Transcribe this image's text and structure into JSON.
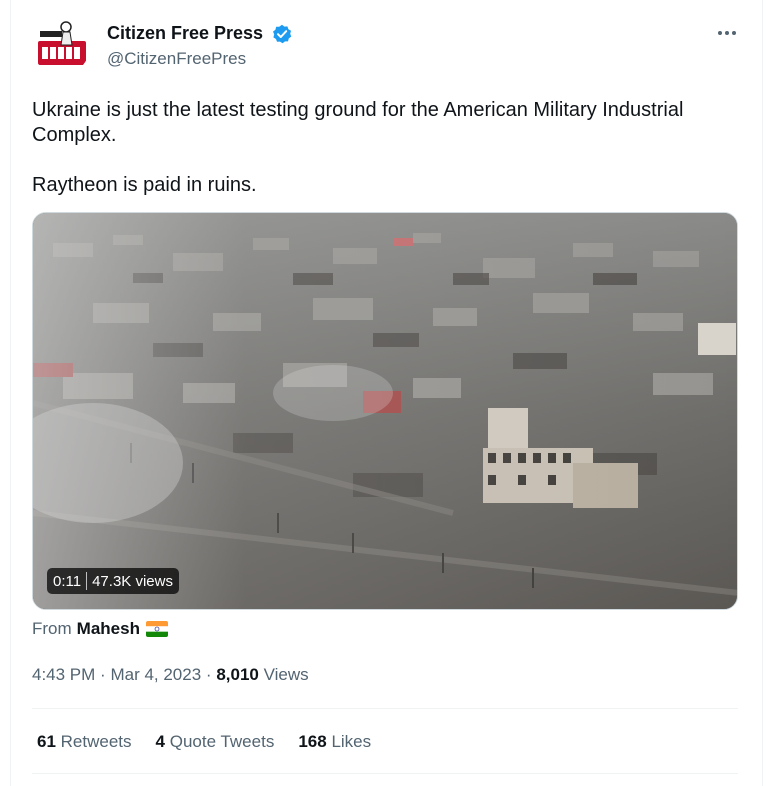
{
  "author": {
    "display_name": "Citizen Free Press",
    "handle": "@CitizenFreePres",
    "verified": true,
    "avatar_icon": "newspaper-logo-icon"
  },
  "tweet": {
    "text_line1": "Ukraine is just the latest testing ground for the American Military Industrial Complex.",
    "text_line2": "Raytheon is paid in ruins."
  },
  "media": {
    "type": "video",
    "duration": "0:11",
    "views": "47.3K views",
    "description_icon": "aerial-ruined-city-video"
  },
  "from_label": "From",
  "from_name": "Mahesh",
  "from_flag": "india-flag-icon",
  "meta": {
    "time": "4:43 PM",
    "separator": "·",
    "date": "Mar 4, 2023",
    "views_count": "8,010",
    "views_label": "Views"
  },
  "stats": {
    "retweets_count": "61",
    "retweets_label": "Retweets",
    "quotes_count": "4",
    "quotes_label": "Quote Tweets",
    "likes_count": "168",
    "likes_label": "Likes"
  },
  "colors": {
    "verified_blue": "#1d9bf0",
    "secondary_text": "#536471",
    "primary_text": "#0f1419"
  }
}
